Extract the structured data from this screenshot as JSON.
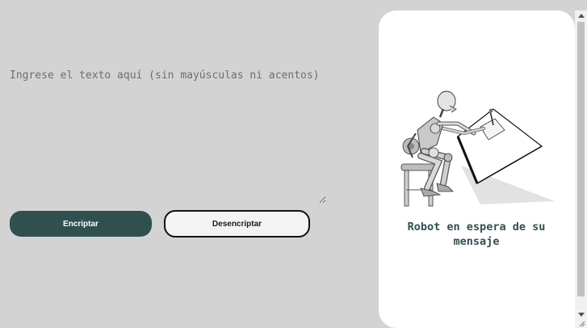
{
  "input": {
    "placeholder": "Ingrese el texto aquí (sin mayúsculas ni acentos)"
  },
  "buttons": {
    "encrypt_label": "Encriptar",
    "decrypt_label": "Desencriptar"
  },
  "panel": {
    "image_icon": "robot-drawing-icon",
    "message": "Robot en espera de su mensaje"
  },
  "colors": {
    "background": "#d3d3d3",
    "accent": "#2f504f",
    "panel": "#ffffff"
  }
}
